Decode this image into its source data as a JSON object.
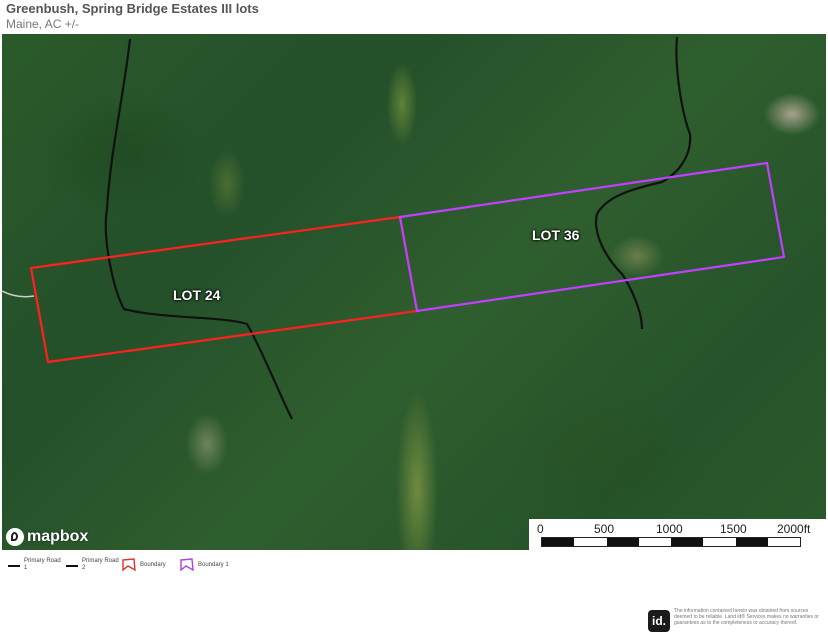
{
  "header": {
    "title": "Greenbush, Spring Bridge Estates III lots",
    "subtitle": "Maine,  AC +/-"
  },
  "map": {
    "lots": [
      {
        "label": "LOT 24",
        "color": "#ff2020"
      },
      {
        "label": "LOT 36",
        "color": "#c040ff"
      }
    ],
    "road_color": "#111111",
    "attribution": "mapbox",
    "scale": {
      "labels": [
        "0",
        "500",
        "1000",
        "1500",
        "2000ft"
      ]
    }
  },
  "legend": {
    "items": [
      {
        "label": "Primary Road\n1",
        "kind": "line",
        "color": "#111111"
      },
      {
        "label": "Primary Road\n2",
        "kind": "line",
        "color": "#111111"
      },
      {
        "label": "Boundary",
        "kind": "polygon",
        "color": "#e03030"
      },
      {
        "label": "Boundary 1",
        "kind": "polygon",
        "color": "#b040e0"
      }
    ]
  },
  "footer": {
    "logo": "id.",
    "disclaimer": "The information contained herein was obtained from sources deemed to be reliable. Land id® Services makes no warranties or guarantees as to the completeness or accuracy thereof."
  }
}
